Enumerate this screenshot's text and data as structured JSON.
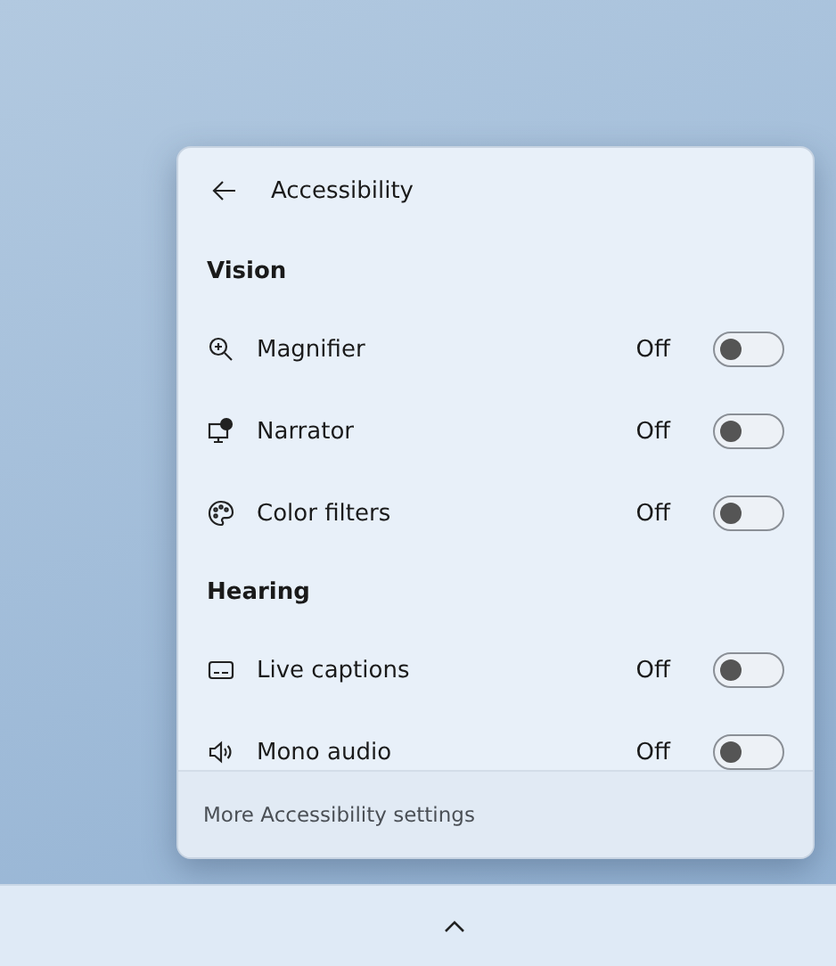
{
  "panel": {
    "title": "Accessibility",
    "sections": [
      {
        "heading": "Vision",
        "items": [
          {
            "label": "Magnifier",
            "state_text": "Off",
            "on": false
          },
          {
            "label": "Narrator",
            "state_text": "Off",
            "on": false
          },
          {
            "label": "Color filters",
            "state_text": "Off",
            "on": false
          }
        ]
      },
      {
        "heading": "Hearing",
        "items": [
          {
            "label": "Live captions",
            "state_text": "Off",
            "on": false
          },
          {
            "label": "Mono audio",
            "state_text": "Off",
            "on": false
          }
        ]
      }
    ],
    "footer_link": "More Accessibility settings"
  }
}
